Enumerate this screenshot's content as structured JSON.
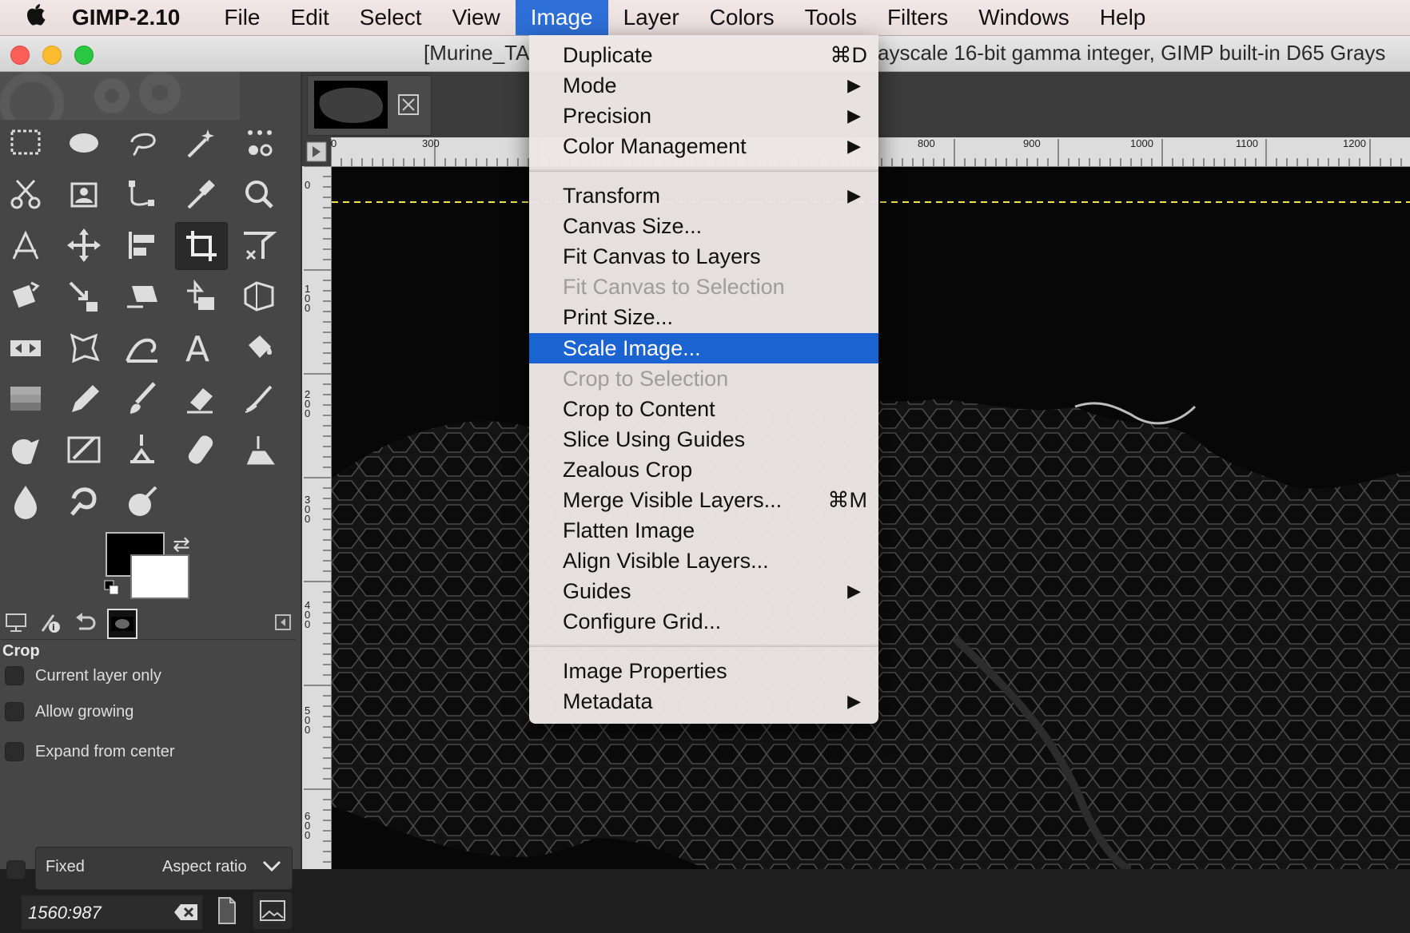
{
  "menubar": {
    "apple": "",
    "app_name": "GIMP-2.10",
    "items": [
      "File",
      "Edit",
      "Select",
      "View",
      "Image",
      "Layer",
      "Colors",
      "Tools",
      "Filters",
      "Windows",
      "Help"
    ],
    "active": "Image"
  },
  "window": {
    "title_left": "[Murine_TA",
    "title_right": "ayscale 16-bit gamma integer, GIMP built-in D65 Grays"
  },
  "image_menu": {
    "items": [
      {
        "label": "Duplicate",
        "shortcut": "⌘D"
      },
      {
        "label": "Mode",
        "submenu": "▶"
      },
      {
        "label": "Precision",
        "submenu": "▶"
      },
      {
        "label": "Color Management",
        "submenu": "▶"
      },
      {
        "label": "Transform",
        "submenu": "▶"
      },
      {
        "label": "Canvas Size..."
      },
      {
        "label": "Fit Canvas to Layers"
      },
      {
        "label": "Fit Canvas to Selection",
        "disabled": true
      },
      {
        "label": "Print Size..."
      },
      {
        "label": "Scale Image...",
        "highlighted": true
      },
      {
        "label": "Crop to Selection",
        "disabled": true
      },
      {
        "label": "Crop to Content"
      },
      {
        "label": "Slice Using Guides"
      },
      {
        "label": "Zealous Crop"
      },
      {
        "label": "Merge Visible Layers...",
        "shortcut": "⌘M"
      },
      {
        "label": "Flatten Image"
      },
      {
        "label": "Align Visible Layers..."
      },
      {
        "label": "Guides",
        "submenu": "▶"
      },
      {
        "label": "Configure Grid..."
      },
      {
        "label": "Image Properties"
      },
      {
        "label": "Metadata",
        "submenu": "▶"
      }
    ]
  },
  "toolbox": {
    "tool_icons": [
      "rect-select-icon",
      "ellipse-select-icon",
      "free-select-icon",
      "fuzzy-select-icon",
      "color-select-icon",
      "scissors-icon",
      "foreground-select-icon",
      "paths-icon",
      "color-picker-icon",
      "zoom-icon",
      "measure-icon",
      "move-icon",
      "align-icon",
      "crop-icon",
      "unified-transform-icon",
      "rotate-icon",
      "scale-icon",
      "shear-icon",
      "flip-icon",
      "perspective-icon",
      "flip-horizontal-icon",
      "cage-icon",
      "warp-icon",
      "text-icon",
      "bucket-fill-icon",
      "blend-icon",
      "pencil-icon",
      "paintbrush-icon",
      "eraser-icon",
      "airbrush-icon",
      "ink-icon",
      "mypaint-icon",
      "clone-icon",
      "heal-icon",
      "perspective-clone-icon",
      "blur-icon",
      "smudge-icon",
      "dodge-burn-icon"
    ],
    "selected_tool": "crop-icon",
    "foreground_color": "#000000",
    "background_color": "#ffffff"
  },
  "tool_options": {
    "title": "Crop",
    "options": [
      "Current layer only",
      "Allow growing",
      "Expand from center"
    ],
    "fixed_label": "Fixed",
    "fixed_mode": "Aspect ratio",
    "ratio_value": "1560:987"
  },
  "ruler": {
    "top_labels": [
      "0",
      "300",
      "800",
      "900",
      "1000",
      "1100",
      "1200"
    ],
    "left_labels": [
      "0",
      "100",
      "200",
      "300",
      "400",
      "500",
      "600"
    ]
  },
  "colors": {
    "accent": "#1b63d1",
    "menubar_active": "#2d6fd6",
    "guide": "#f2e64b"
  }
}
